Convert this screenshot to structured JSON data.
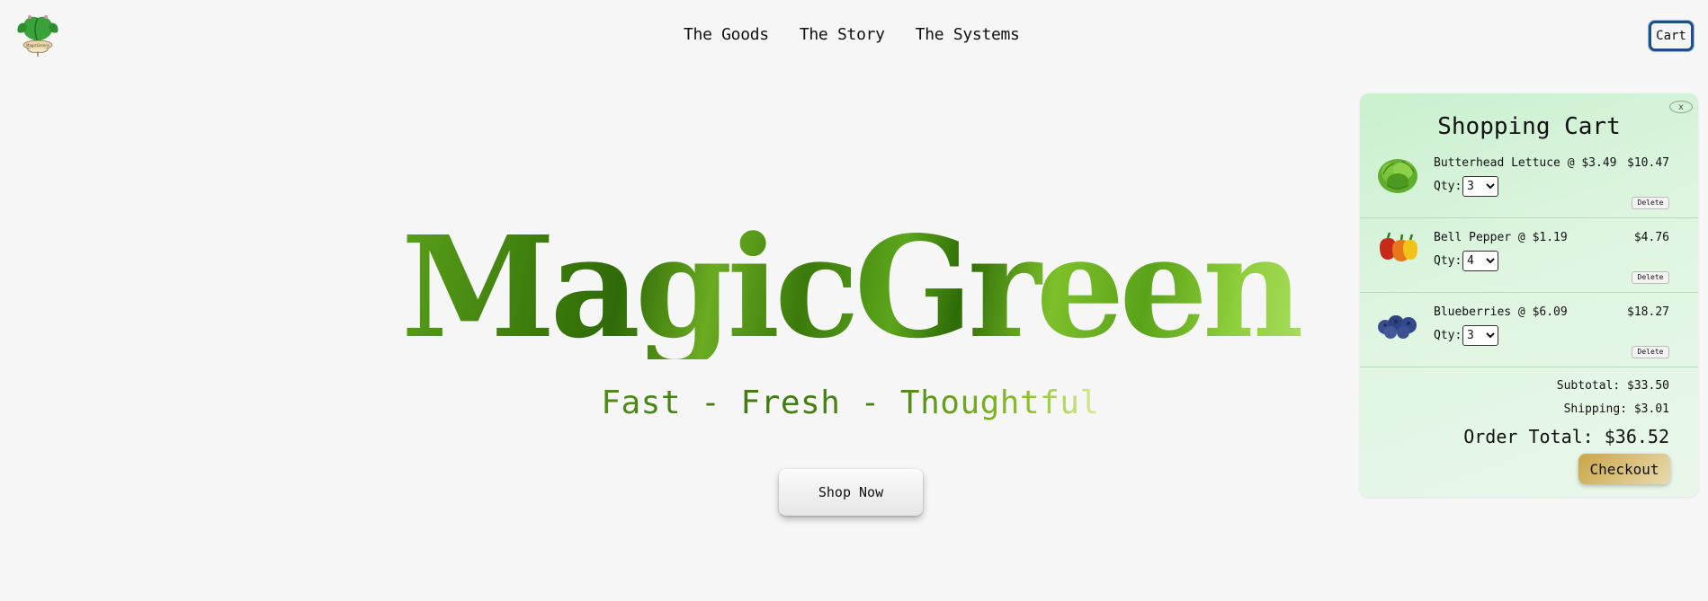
{
  "header": {
    "logo_icon": "leaf-logo-icon",
    "nav": [
      "The Goods",
      "The Story",
      "The Systems"
    ],
    "cart_label": "Cart"
  },
  "hero": {
    "title": "MagicGreens",
    "tagline": "Fast - Fresh - Thoughtful",
    "cta_label": "Shop Now"
  },
  "cart": {
    "title": "Shopping Cart",
    "close_label": "x",
    "qty_label": "Qty:",
    "delete_label": "Delete",
    "items": [
      {
        "name": "Butterhead Lettuce @ $3.49",
        "total": "$10.47",
        "qty": "3",
        "icon": "lettuce-icon"
      },
      {
        "name": "Bell Pepper @ $1.19",
        "total": "$4.76",
        "qty": "4",
        "icon": "bell-pepper-icon"
      },
      {
        "name": "Blueberries @ $6.09",
        "total": "$18.27",
        "qty": "3",
        "icon": "blueberries-icon"
      }
    ],
    "subtotal": "Subtotal: $33.50",
    "shipping": "Shipping: $3.01",
    "order_total": "Order Total: $36.52",
    "checkout_label": "Checkout"
  },
  "colors": {
    "brand_green": "#3e7f0e",
    "cart_bg": "#d6f3d9",
    "checkout_gold": "#d9c07a",
    "cart_border": "#1c4f8a"
  }
}
